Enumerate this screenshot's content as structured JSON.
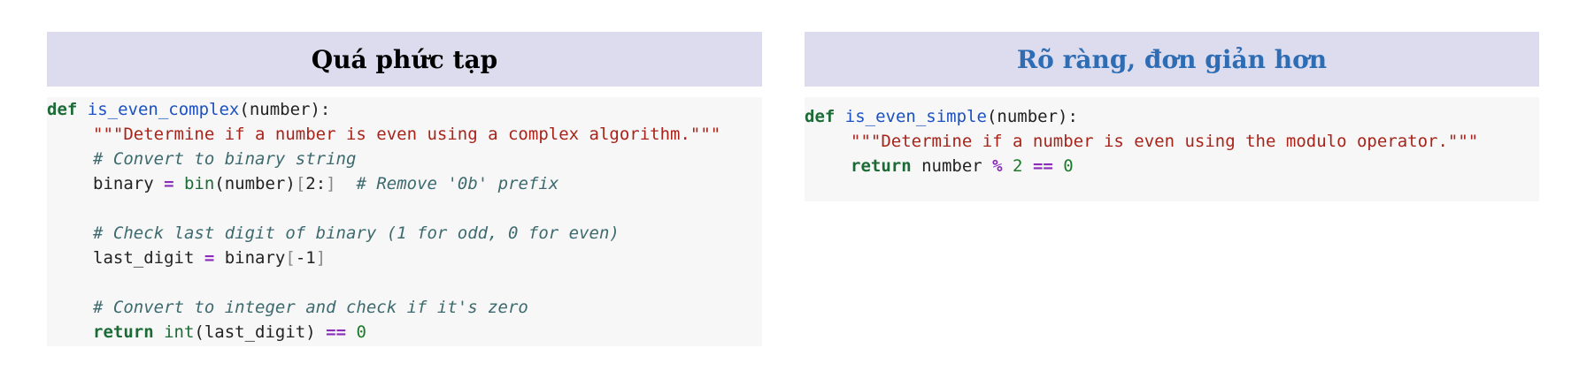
{
  "left_panel": {
    "title": "Quá phức tạp",
    "code": {
      "l1_kw": "def",
      "l1_fn": "is_even_complex",
      "l1_rest": "(number):",
      "l2_str": "\"\"\"Determine if a number is even using a complex algorithm.\"\"\"",
      "l3_cmt": "# Convert to binary string",
      "l4_var": "binary ",
      "l4_op": "=",
      "l4_bi": " bin",
      "l4_args": "(number)",
      "l4_lbr": "[",
      "l4_slice": "2:",
      "l4_rbr": "]",
      "l4_cmt": "  # Remove '0b' prefix",
      "l6_cmt": "# Check last digit of binary (1 for odd, 0 for even)",
      "l7_var": "last_digit ",
      "l7_op": "=",
      "l7_mid": " binary",
      "l7_lbr": "[",
      "l7_idx": "-1",
      "l7_rbr": "]",
      "l9_cmt": "# Convert to integer and check if it's zero",
      "l10_kw": "return",
      "l10_bi": " int",
      "l10_args": "(last_digit) ",
      "l10_op": "==",
      "l10_num": " 0"
    }
  },
  "right_panel": {
    "title": "Rõ ràng, đơn giản hơn",
    "code": {
      "l1_kw": "def",
      "l1_fn": "is_even_simple",
      "l1_rest": "(number):",
      "l2_str": "\"\"\"Determine if a number is even using the modulo operator.\"\"\"",
      "l3_kw": "return",
      "l3_var": " number ",
      "l3_op1": "%",
      "l3_num1": " 2 ",
      "l3_op2": "==",
      "l3_num2": " 0"
    }
  },
  "colors": {
    "header_bg": "#dcdcee",
    "right_title": "#2e6db4",
    "code_bg": "#f7f7f7",
    "keyword": "#1c6b36",
    "function": "#1b51c2",
    "string": "#a8241a",
    "comment": "#3d6a6e",
    "operator": "#8a2bb9"
  }
}
